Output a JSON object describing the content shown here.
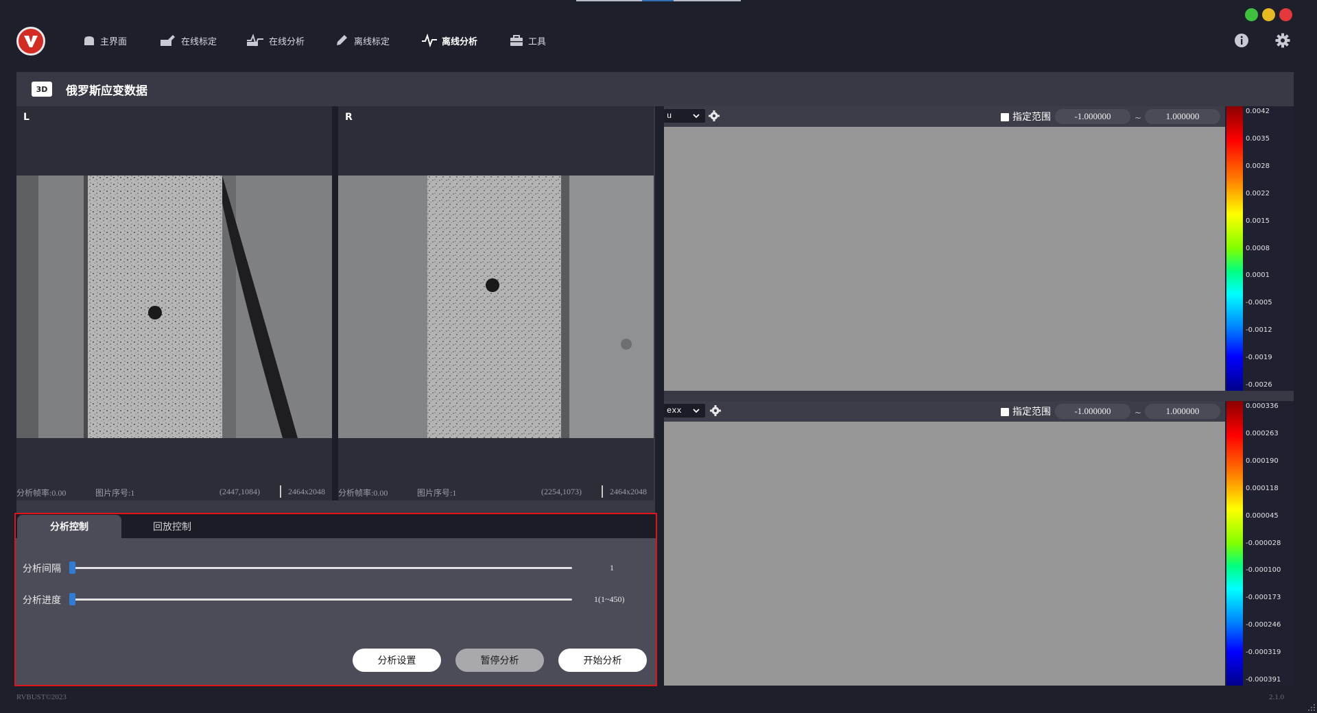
{
  "window": {
    "traffic_lights": [
      {
        "name": "green",
        "color": "#3ec13c"
      },
      {
        "name": "yellow",
        "color": "#e8b923"
      },
      {
        "name": "red",
        "color": "#e5383c"
      }
    ]
  },
  "nav": {
    "items": [
      {
        "label": "主界面",
        "icon": "home-icon"
      },
      {
        "label": "在线标定",
        "icon": "online-calibration-icon"
      },
      {
        "label": "在线分析",
        "icon": "online-analysis-icon"
      },
      {
        "label": "离线标定",
        "icon": "offline-calibration-icon"
      },
      {
        "label": "离线分析",
        "icon": "offline-analysis-icon",
        "active": true
      },
      {
        "label": "工具",
        "icon": "toolbox-icon"
      }
    ],
    "right_icons": [
      "info-icon",
      "settings-gear-icon"
    ]
  },
  "page": {
    "badge": "3D",
    "title": "俄罗斯应变数据"
  },
  "cameras": {
    "left": {
      "label": "L",
      "fps_label": "分析帧率:0.00",
      "index_label": "图片序号:1",
      "coords": "(2447,1084)",
      "resolution": "2464x2048"
    },
    "right": {
      "label": "R",
      "fps_label": "分析帧率:0.00",
      "index_label": "图片序号:1",
      "coords": "(2254,1073)",
      "resolution": "2464x2048"
    }
  },
  "plots": [
    {
      "field": "u",
      "range_label": "指定范围",
      "range_min": "-1.000000",
      "range_sep": "~",
      "range_max": "1.000000",
      "colorbar": [
        "0.0042",
        "0.0035",
        "0.0028",
        "0.0022",
        "0.0015",
        "0.0008",
        "0.0001",
        "-0.0005",
        "-0.0012",
        "-0.0019",
        "-0.0026"
      ]
    },
    {
      "field": "exx",
      "range_label": "指定范围",
      "range_min": "-1.000000",
      "range_sep": "~",
      "range_max": "1.000000",
      "colorbar": [
        "0.000336",
        "0.000263",
        "0.000190",
        "0.000118",
        "0.000045",
        "-0.000028",
        "-0.000100",
        "-0.000173",
        "-0.000246",
        "-0.000319",
        "-0.000391"
      ]
    }
  ],
  "control": {
    "tabs": [
      {
        "label": "分析控制",
        "active": true
      },
      {
        "label": "回放控制",
        "active": false
      }
    ],
    "sliders": [
      {
        "label": "分析间隔",
        "value": "1",
        "position": 0.0
      },
      {
        "label": "分析进度",
        "value": "1(1~450)",
        "position": 0.0
      }
    ],
    "buttons": [
      {
        "label": "分析设置",
        "color": "#ffffff"
      },
      {
        "label": "暂停分析",
        "color": "#a9a9ad"
      },
      {
        "label": "开始分析",
        "color": "#ffffff"
      }
    ]
  },
  "footer": {
    "copyright": "RVBUST©2023",
    "version": "2.1.0"
  },
  "colors": {
    "background": "#1d1f2b",
    "panel": "#383945",
    "highlight_border": "#e0141b",
    "accent": "#2f7cd4"
  }
}
